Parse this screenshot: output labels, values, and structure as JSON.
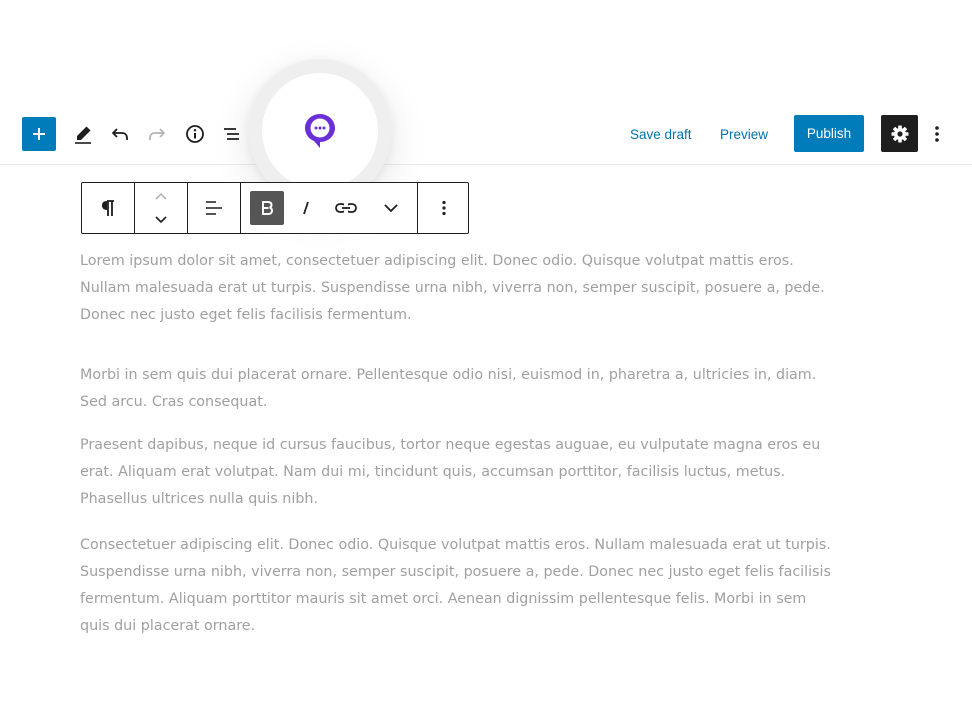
{
  "header": {
    "save_draft_label": "Save draft",
    "preview_label": "Preview",
    "publish_label": "Publish"
  },
  "colors": {
    "accent": "#007cba",
    "link": "#0073aa",
    "dark": "#1e1e1e",
    "text": "#a0a0a0",
    "plugin_purple": "#6a2fd6"
  },
  "icons": {
    "toolbar": [
      "plus-icon",
      "pencil-icon",
      "undo-icon",
      "redo-icon",
      "info-icon",
      "list-view-icon",
      "chat-bubble-icon",
      "gear-icon",
      "more-vertical-icon"
    ],
    "block_toolbar": [
      "paragraph-icon",
      "chevron-up-icon",
      "chevron-down-icon",
      "align-left-icon",
      "bold-icon",
      "italic-icon",
      "link-icon",
      "chevron-down-icon",
      "more-vertical-icon"
    ]
  },
  "content": {
    "paragraphs": [
      "Lorem ipsum dolor sit amet, consectetuer adipiscing elit. Donec odio. Quisque volutpat mattis eros. Nullam malesuada erat ut turpis. Suspendisse urna nibh, viverra non, semper suscipit, posuere a, pede. Donec nec justo eget felis facilisis fermentum.",
      "Morbi in sem quis dui placerat ornare. Pellentesque odio nisi, euismod in, pharetra a, ultricies in, diam. Sed arcu. Cras consequat.",
      "Praesent dapibus, neque id cursus faucibus, tortor neque egestas auguae, eu vulputate magna eros eu erat. Aliquam erat volutpat. Nam dui mi, tincidunt quis, accumsan porttitor, facilisis luctus, metus. Phasellus ultrices nulla quis nibh.",
      "Consectetuer adipiscing elit. Donec odio. Quisque volutpat mattis eros. Nullam malesuada erat ut turpis. Suspendisse urna nibh, viverra non, semper suscipit, posuere a, pede. Donec nec justo eget felis facilisis fermentum. Aliquam porttitor mauris sit amet orci. Aenean dignissim pellentesque felis. Morbi in sem quis dui placerat ornare."
    ]
  }
}
